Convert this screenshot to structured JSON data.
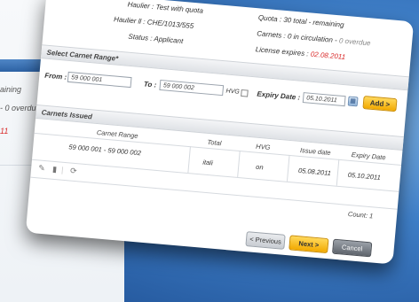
{
  "background": {
    "text1": "aining",
    "text2": "- 0  overdu",
    "text3": "11"
  },
  "header": {
    "haulier_label": "Haulier : Test with quota",
    "haulier_id": "Haulier ll : CHE/1013/555",
    "status": "Status : Applicant",
    "quota": "Quota : 30  total  -  remaining",
    "carnets_prefix": "Carnets : 0  in circulation  -  ",
    "carnets_overdue": "0  overdue",
    "license_prefix": "License expires : ",
    "license_date": "02.08.2011"
  },
  "range": {
    "title": "Select Carnet Range*",
    "from_label": "From :",
    "from_value": "59 000 001",
    "to_label": "To :",
    "to_value": "59 000 002",
    "hvg_label": "HVG",
    "expiry_label": "Expiry Date :",
    "expiry_value": "05.10.2011",
    "add_label": "Add >"
  },
  "issued": {
    "title": "Carnets Issued",
    "columns": [
      "Carnet Range",
      "Total",
      "HVG",
      "Issue date",
      "Expiry Date"
    ],
    "rows": [
      {
        "range": "59 000 001 - 59 000 002",
        "total": "itali",
        "hvg": "on",
        "issue": "05.08.2011",
        "expiry": "05.10.2011"
      }
    ],
    "count": "Count: 1"
  },
  "footer": {
    "previous": "< Previous",
    "next": "Next >",
    "cancel": "Cancel"
  },
  "colors": {
    "accent": "#f2a900",
    "alert": "#d92b2b",
    "backdrop": "#3f7fc8"
  }
}
